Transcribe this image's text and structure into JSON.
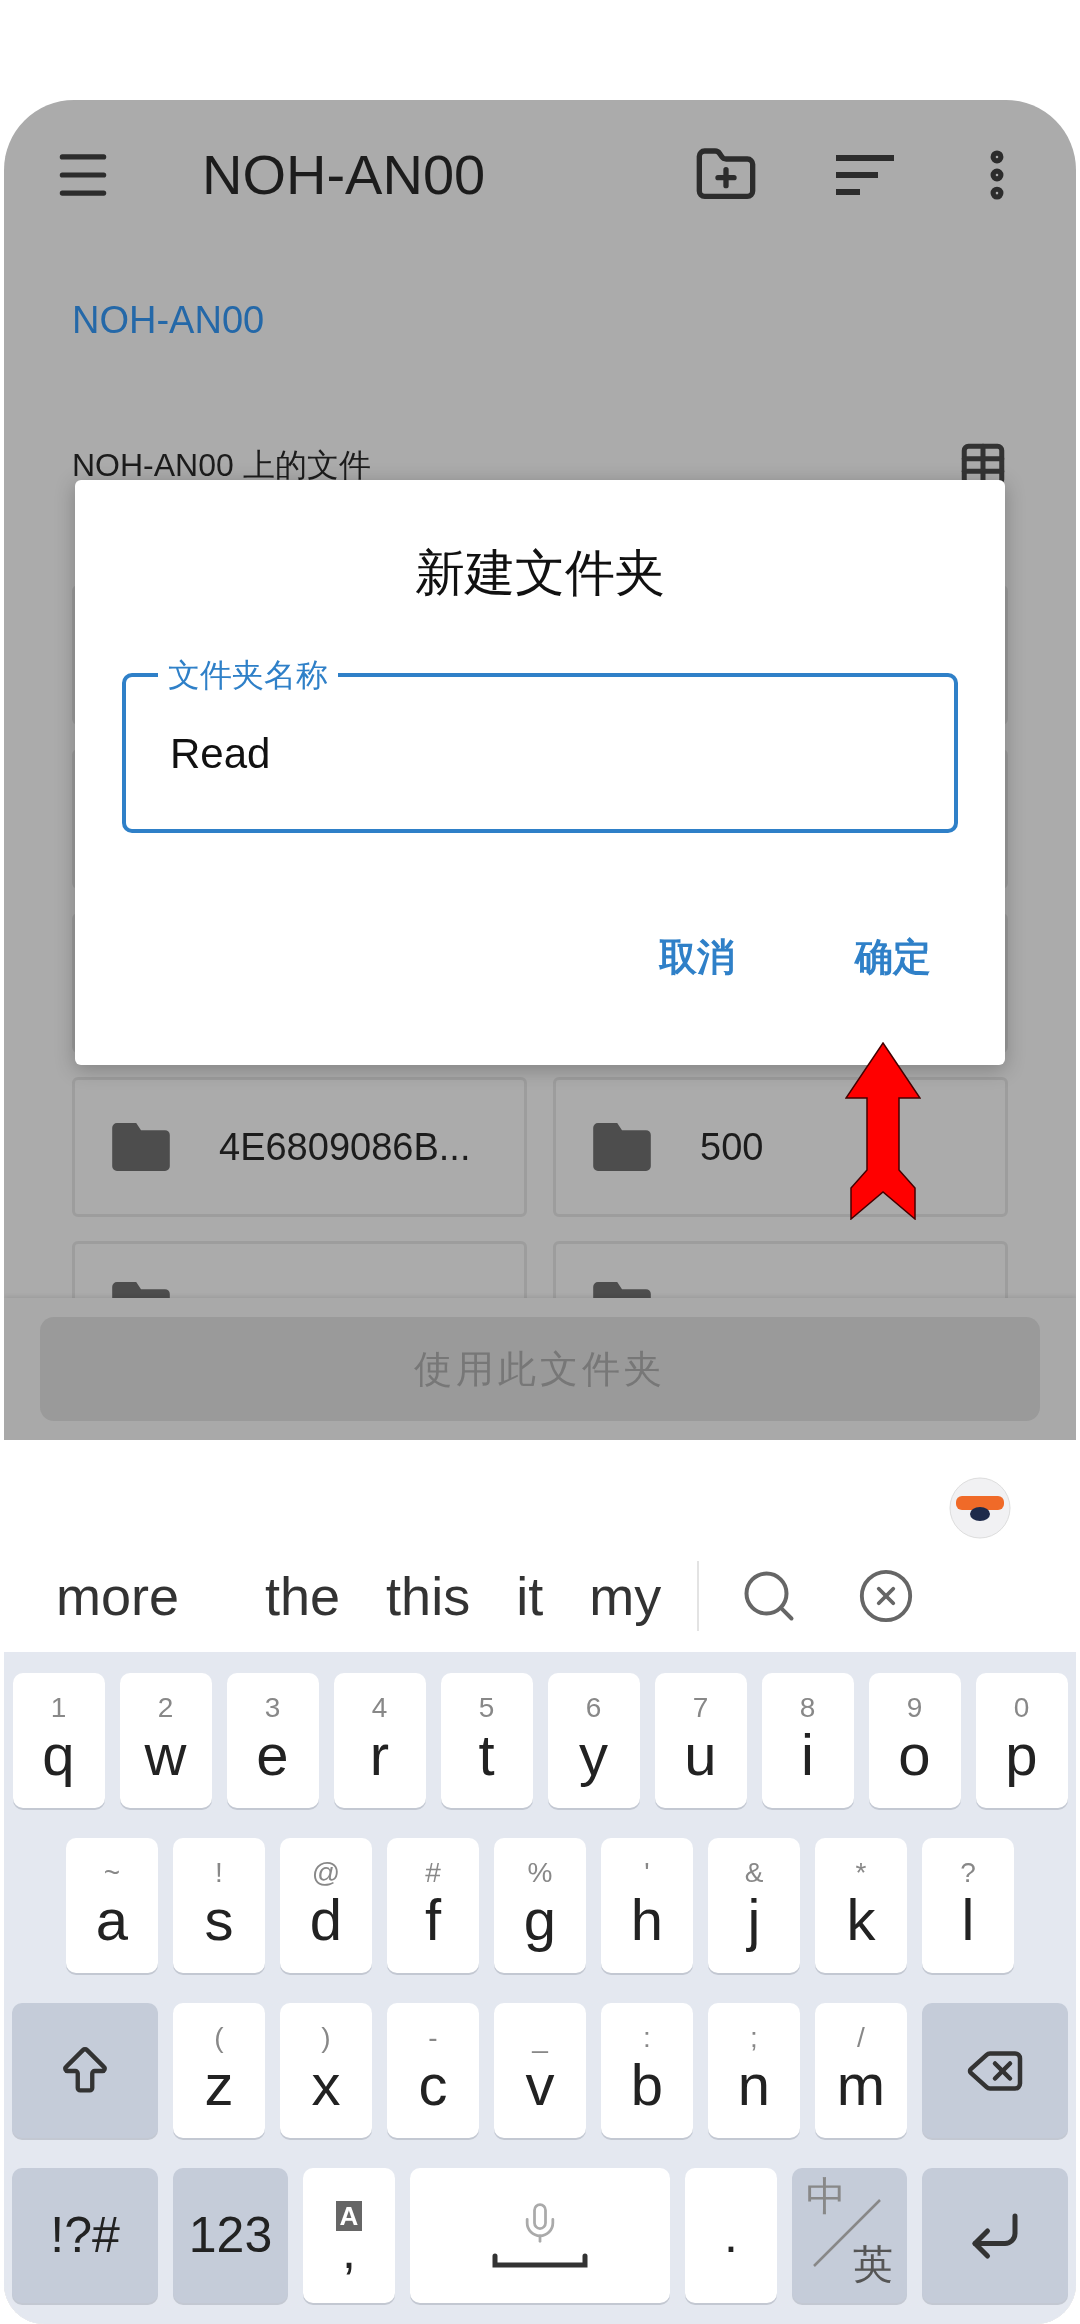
{
  "toolbar": {
    "title": "NOH-AN00"
  },
  "breadcrumb": "NOH-AN00",
  "section_title": "NOH-AN00 上的文件",
  "folders": [
    {
      "name": "4E6809086B..."
    },
    {
      "name": "500"
    }
  ],
  "bottom_button": {
    "label": "使用此文件夹",
    "disabled": true
  },
  "dialog": {
    "title": "新建文件夹",
    "field": {
      "label": "文件夹名称",
      "value": "Read"
    },
    "buttons": [
      "取消",
      "确定"
    ]
  },
  "keyboard": {
    "suggestions": [
      "more",
      "the",
      "this",
      "it",
      "my"
    ],
    "rows": [
      {
        "keys": [
          {
            "kind": "letter",
            "label": "q",
            "hint": "1"
          },
          {
            "kind": "letter",
            "label": "w",
            "hint": "2"
          },
          {
            "kind": "letter",
            "label": "e",
            "hint": "3"
          },
          {
            "kind": "letter",
            "label": "r",
            "hint": "4"
          },
          {
            "kind": "letter",
            "label": "t",
            "hint": "5"
          },
          {
            "kind": "letter",
            "label": "y",
            "hint": "6"
          },
          {
            "kind": "letter",
            "label": "u",
            "hint": "7"
          },
          {
            "kind": "letter",
            "label": "i",
            "hint": "8"
          },
          {
            "kind": "letter",
            "label": "o",
            "hint": "9"
          },
          {
            "kind": "letter",
            "label": "p",
            "hint": "0"
          }
        ]
      },
      {
        "keys": [
          {
            "kind": "letter",
            "label": "a",
            "hint": "~"
          },
          {
            "kind": "letter",
            "label": "s",
            "hint": "!"
          },
          {
            "kind": "letter",
            "label": "d",
            "hint": "@"
          },
          {
            "kind": "letter",
            "label": "f",
            "hint": "#"
          },
          {
            "kind": "letter",
            "label": "g",
            "hint": "%"
          },
          {
            "kind": "letter",
            "label": "h",
            "hint": "'"
          },
          {
            "kind": "letter",
            "label": "j",
            "hint": "&"
          },
          {
            "kind": "letter",
            "label": "k",
            "hint": "*"
          },
          {
            "kind": "letter",
            "label": "l",
            "hint": "?"
          }
        ]
      },
      {
        "keys": [
          {
            "kind": "shift"
          },
          {
            "kind": "letter",
            "label": "z",
            "hint": "("
          },
          {
            "kind": "letter",
            "label": "x",
            "hint": ")"
          },
          {
            "kind": "letter",
            "label": "c",
            "hint": "-"
          },
          {
            "kind": "letter",
            "label": "v",
            "hint": "_"
          },
          {
            "kind": "letter",
            "label": "b",
            "hint": ":"
          },
          {
            "kind": "letter",
            "label": "n",
            "hint": ";"
          },
          {
            "kind": "letter",
            "label": "m",
            "hint": "/"
          },
          {
            "kind": "backspace"
          }
        ]
      },
      {
        "keys": [
          {
            "kind": "symbols",
            "label": "!?#"
          },
          {
            "kind": "numbers",
            "label": "123"
          },
          {
            "kind": "comma",
            "label": ",",
            "badge": "A"
          },
          {
            "kind": "space"
          },
          {
            "kind": "period",
            "label": "."
          },
          {
            "kind": "language",
            "label": "中",
            "label2": "英"
          },
          {
            "kind": "enter"
          }
        ]
      }
    ]
  }
}
